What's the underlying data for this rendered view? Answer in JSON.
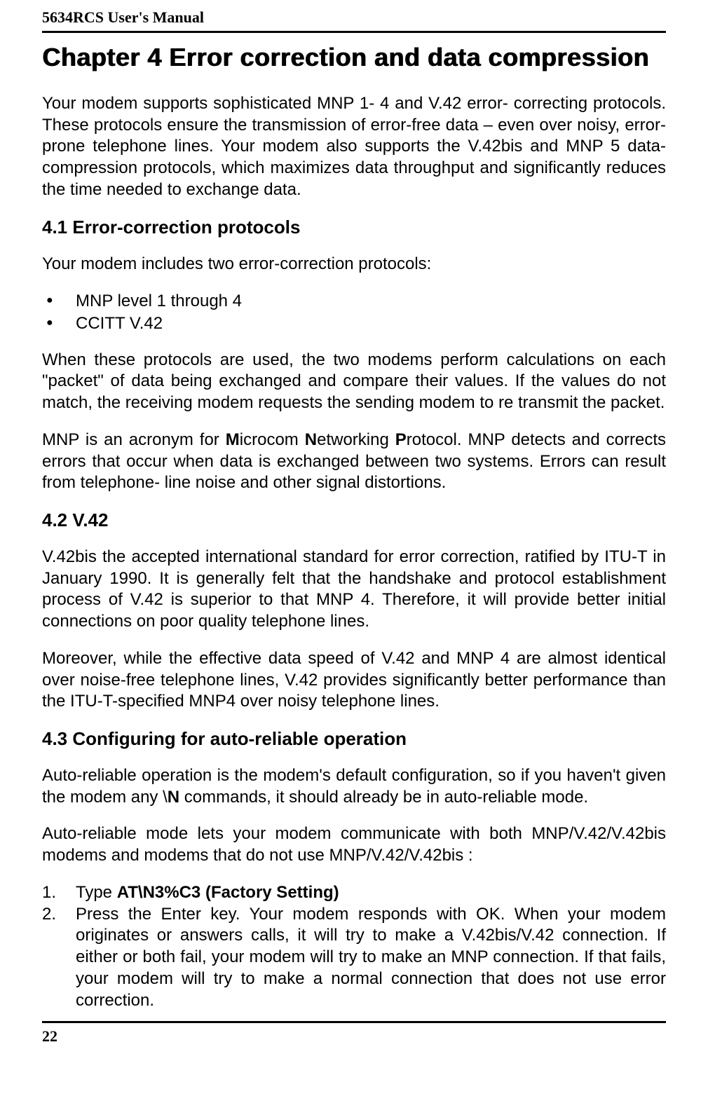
{
  "header": {
    "manual_title": "5634RCS User's Manual"
  },
  "chapter": {
    "title": "Chapter 4 Error correction and data compression"
  },
  "body": {
    "p_intro": "Your modem supports sophisticated MNP 1- 4 and V.42 error- correcting protocols. These protocols ensure the transmission of error-free data – even over noisy, error- prone telephone lines. Your modem also supports the V.42bis and MNP 5 data-compression protocols, which maximizes data throughput and significantly reduces the time needed to exchange data.",
    "s41": {
      "heading": "4.1 Error-correction protocols",
      "p1": "Your modem includes two error-correction protocols:",
      "bullets": [
        "MNP level 1 through 4",
        "CCITT V.42"
      ],
      "p2": "When these protocols are used, the two modems perform calculations on each \"packet\" of data being exchanged and compare their values. If the values do not match, the receiving modem requests the sending modem to re transmit the packet.",
      "p3_pre": "MNP is an acronym for ",
      "p3_bM": "M",
      "p3_t1": "icrocom ",
      "p3_bN": "N",
      "p3_t2": "etworking ",
      "p3_bP": "P",
      "p3_t3": "rotocol. MNP detects and corrects errors that occur when data is exchanged between two systems. Errors can result from telephone- line noise and other signal distortions."
    },
    "s42": {
      "heading": "4.2 V.42",
      "p1": "V.42bis the accepted international standard for error correction, ratified by ITU-T in January 1990. It is generally felt that the handshake and protocol establishment process of V.42 is superior to that MNP 4. Therefore, it will provide better initial connections on poor quality telephone lines.",
      "p2": "Moreover, while the effective data speed of V.42 and MNP 4 are almost identical over noise-free telephone lines, V.42 provides significantly better performance than the ITU-T-specified MNP4 over noisy telephone lines."
    },
    "s43": {
      "heading": "4.3 Configuring for auto-reliable operation",
      "p1_pre": "Auto-reliable operation is the modem's default configuration, so if you haven't given the modem any \\",
      "p1_bold": "N",
      "p1_post": " commands, it should already be in auto-reliable mode.",
      "p2": "Auto-reliable mode lets your modem communicate with both MNP/V.42/V.42bis modems and modems that do not use MNP/V.42/V.42bis :",
      "list": {
        "i1_num": "1.",
        "i1_pre": "Type ",
        "i1_bold": "AT\\N3%C3 (Factory Setting)",
        "i2_num": "2.",
        "i2_text": "Press the Enter key. Your modem responds with OK. When your modem originates or answers calls, it will try to make a V.42bis/V.42 connection. If either or both fail, your modem will try to make an MNP connection. If that fails, your modem will try to make a normal connection that does not use error correction."
      }
    }
  },
  "footer": {
    "page_number": "22"
  }
}
